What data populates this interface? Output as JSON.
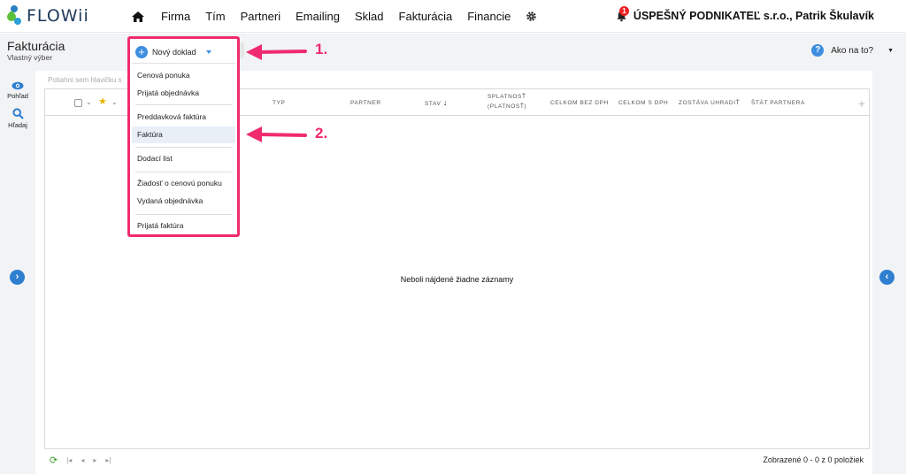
{
  "brand": {
    "name": "FLOWii"
  },
  "nav": {
    "items": [
      "Firma",
      "Tím",
      "Partneri",
      "Emailing",
      "Sklad",
      "Fakturácia",
      "Financie"
    ],
    "notification_count": "1",
    "company": "ÚSPEŠNÝ PODNIKATEĽ s.r.o., Patrik Škulavík"
  },
  "page": {
    "title": "Fakturácia",
    "subtitle": "Vlastný výber"
  },
  "help": {
    "label": "Ako na to?"
  },
  "sidebar": {
    "view_label": "Pohľad",
    "search_label": "Hľadaj"
  },
  "grid": {
    "group_hint": "Potiahni sem hlavičku s",
    "columns": [
      "TYP",
      "PARTNER",
      "STAV",
      "SPLATNOSŤ",
      "(PLATNOSŤ)",
      "CELKOM BEZ DPH",
      "CELKOM S DPH",
      "ZOSTÁVA UHRADIŤ",
      "ŠTÁT PARTNERA"
    ],
    "empty_text": "Neboli nájdené žiadne záznamy",
    "status_text": "Zobrazené 0 - 0 z 0 položiek"
  },
  "new_document": {
    "label": "Nový doklad",
    "menu": [
      "Cenová ponuka",
      "Prijatá objednávka",
      "Preddavková faktúra",
      "Faktúra",
      "Dodací list",
      "Žiadosť o cenovú ponuku",
      "Vydaná objednávka",
      "Prijatá faktúra"
    ],
    "selected": "Faktúra"
  },
  "annotations": [
    "1.",
    "2."
  ],
  "colors": {
    "accent": "#3d8de0",
    "highlight": "#f02a6e",
    "brand_dark": "#1e3a5a"
  }
}
